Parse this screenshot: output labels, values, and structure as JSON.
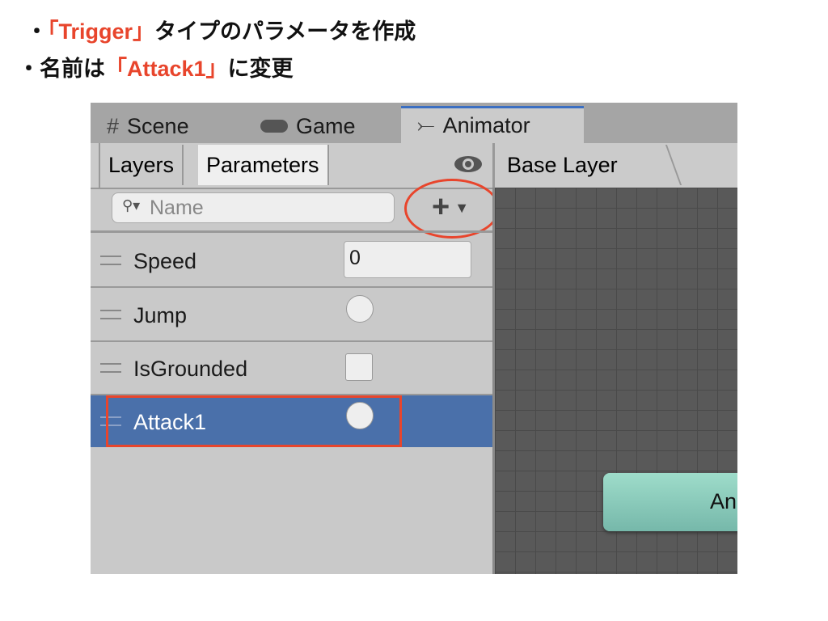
{
  "slide": {
    "line1": {
      "bullet": "・",
      "highlight": "「Trigger」",
      "rest": "タイプのパラメータを作成"
    },
    "line2": {
      "bullet": "・",
      "before": "名前は",
      "highlight": "「Attack1」",
      "rest": "に変更"
    }
  },
  "tabs": [
    {
      "label": "Scene",
      "icon": "grid-icon"
    },
    {
      "label": "Game",
      "icon": "gamepad-icon"
    },
    {
      "label": "Animator",
      "icon": "animator-icon"
    }
  ],
  "subtabs": {
    "layers": "Layers",
    "parameters": "Parameters"
  },
  "breadcrumb": "Base Layer",
  "search": {
    "placeholder": "Name"
  },
  "parameters": [
    {
      "name": "Speed",
      "type": "float",
      "value": "0"
    },
    {
      "name": "Jump",
      "type": "trigger"
    },
    {
      "name": "IsGrounded",
      "type": "bool",
      "checked": false
    },
    {
      "name": "Attack1",
      "type": "trigger",
      "selected": true
    }
  ],
  "node_label": "An",
  "colors": {
    "accent": "#e8452c",
    "selection": "#4a70aa",
    "node": "#8fd3c2"
  }
}
